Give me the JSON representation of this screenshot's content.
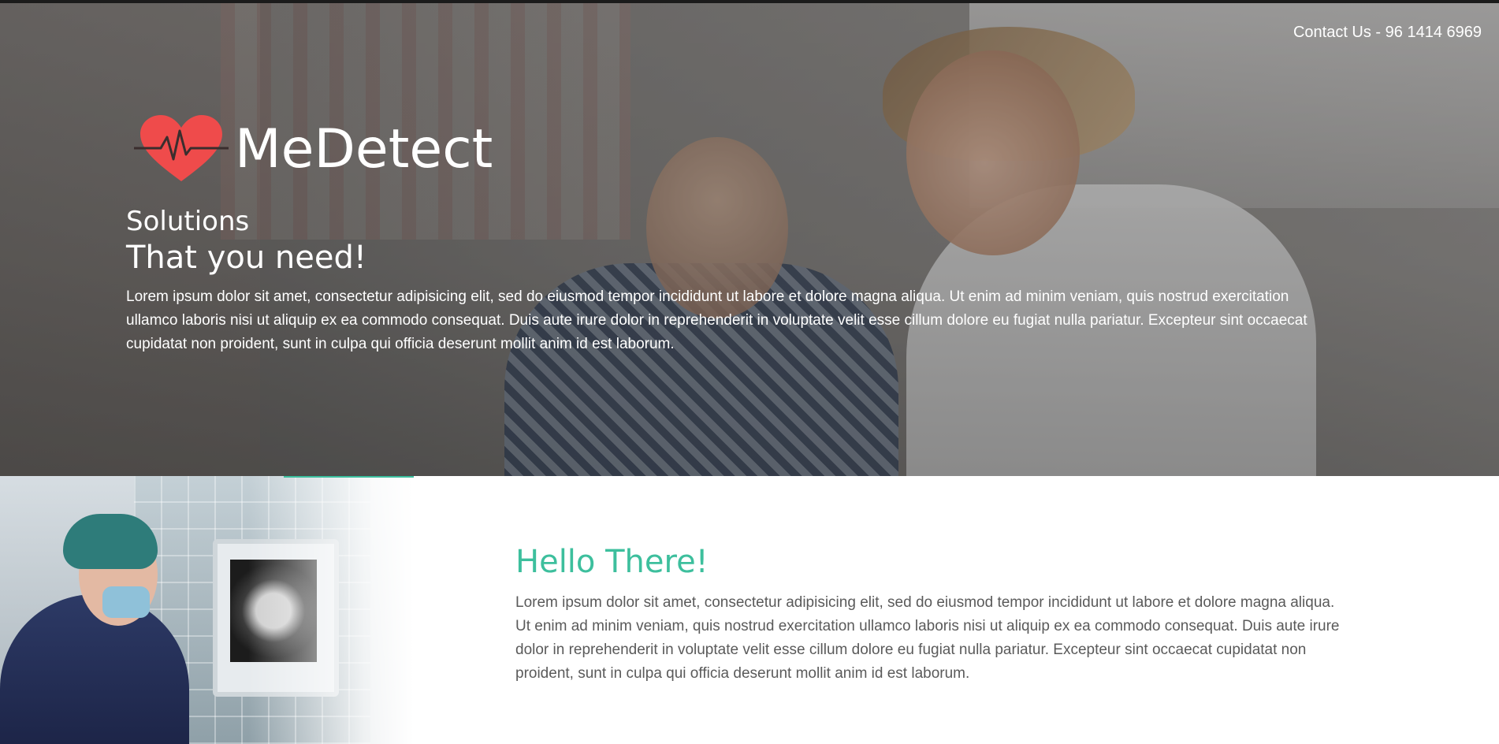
{
  "header": {
    "contact": "Contact Us - 96 1414 6969"
  },
  "brand": {
    "name": "MeDetect",
    "logo_icon": "heart-pulse-icon",
    "accent_color": "#ef4b4b"
  },
  "hero": {
    "subtitle": "Solutions",
    "headline": "That you need!",
    "body": "Lorem ipsum dolor sit amet, consectetur adipisicing elit, sed do eiusmod tempor incididunt ut labore et dolore magna aliqua. Ut enim ad minim veniam, quis nostrud exercitation ullamco laboris nisi ut aliquip ex ea commodo consequat. Duis aute irure dolor in reprehenderit in voluptate velit esse cillum dolore eu fugiat nulla pariatur. Excepteur sint occaecat cupidatat non proident, sunt in culpa qui officia deserunt mollit anim id est laborum."
  },
  "intro": {
    "title": "Hello There!",
    "title_color": "#3dbf9d",
    "body": "Lorem ipsum dolor sit amet, consectetur adipisicing elit, sed do eiusmod tempor incididunt ut labore et dolore magna aliqua. Ut enim ad minim veniam, quis nostrud exercitation ullamco laboris nisi ut aliquip ex ea commodo consequat. Duis aute irure dolor in reprehenderit in voluptate velit esse cillum dolore eu fugiat nulla pariatur. Excepteur sint occaecat cupidatat non proident, sunt in culpa qui officia deserunt mollit anim id est laborum."
  }
}
